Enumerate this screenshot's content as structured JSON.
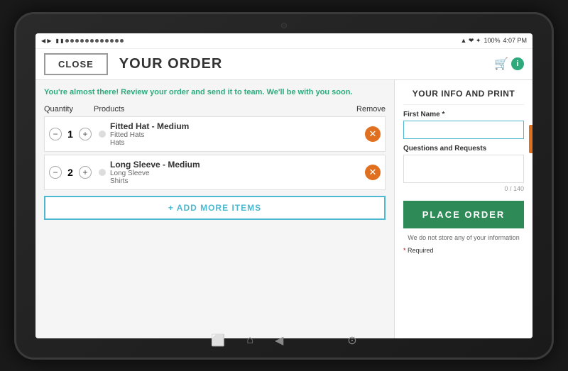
{
  "device": {
    "camera_label": "camera",
    "time": "4:07 PM",
    "battery": "100%"
  },
  "status_bar": {
    "left_icons": "◀ ▶ ■ ▮ ● ● ● ● ● ● ● ● ● ● ● ● ● ●",
    "right_info": "◼ ◂ ❤ ✦ 100%  4:07 PM"
  },
  "top_bar": {
    "close_label": "CLOSE",
    "title": "YOUR ORDER",
    "cart_icon": "🛒"
  },
  "order_section": {
    "review_message": "You're almost there! Review your order and send it to team. We'll be with you soon.",
    "columns": {
      "quantity": "Quantity",
      "products": "Products",
      "remove": "Remove"
    },
    "items": [
      {
        "id": 1,
        "quantity": 1,
        "name": "Fitted Hat - Medium",
        "sub1": "Fitted Hats",
        "sub2": "Hats"
      },
      {
        "id": 2,
        "quantity": 2,
        "name": "Long Sleeve - Medium",
        "sub1": "Long Sleeve",
        "sub2": "Shirts"
      }
    ],
    "add_more_label": "+ ADD MORE ITEMS"
  },
  "right_panel": {
    "title": "YOUR INFO AND PRINT",
    "first_name_label": "First Name *",
    "first_name_placeholder": "",
    "questions_label": "Questions and Requests",
    "questions_placeholder": "",
    "char_count": "0 / 140",
    "place_order_label": "PLACE ORDER",
    "no_store_info": "We do not store any of your information",
    "required_note": "* Required"
  },
  "tablet_nav": {
    "icons": [
      "⬜",
      "⌂",
      "◀"
    ]
  }
}
